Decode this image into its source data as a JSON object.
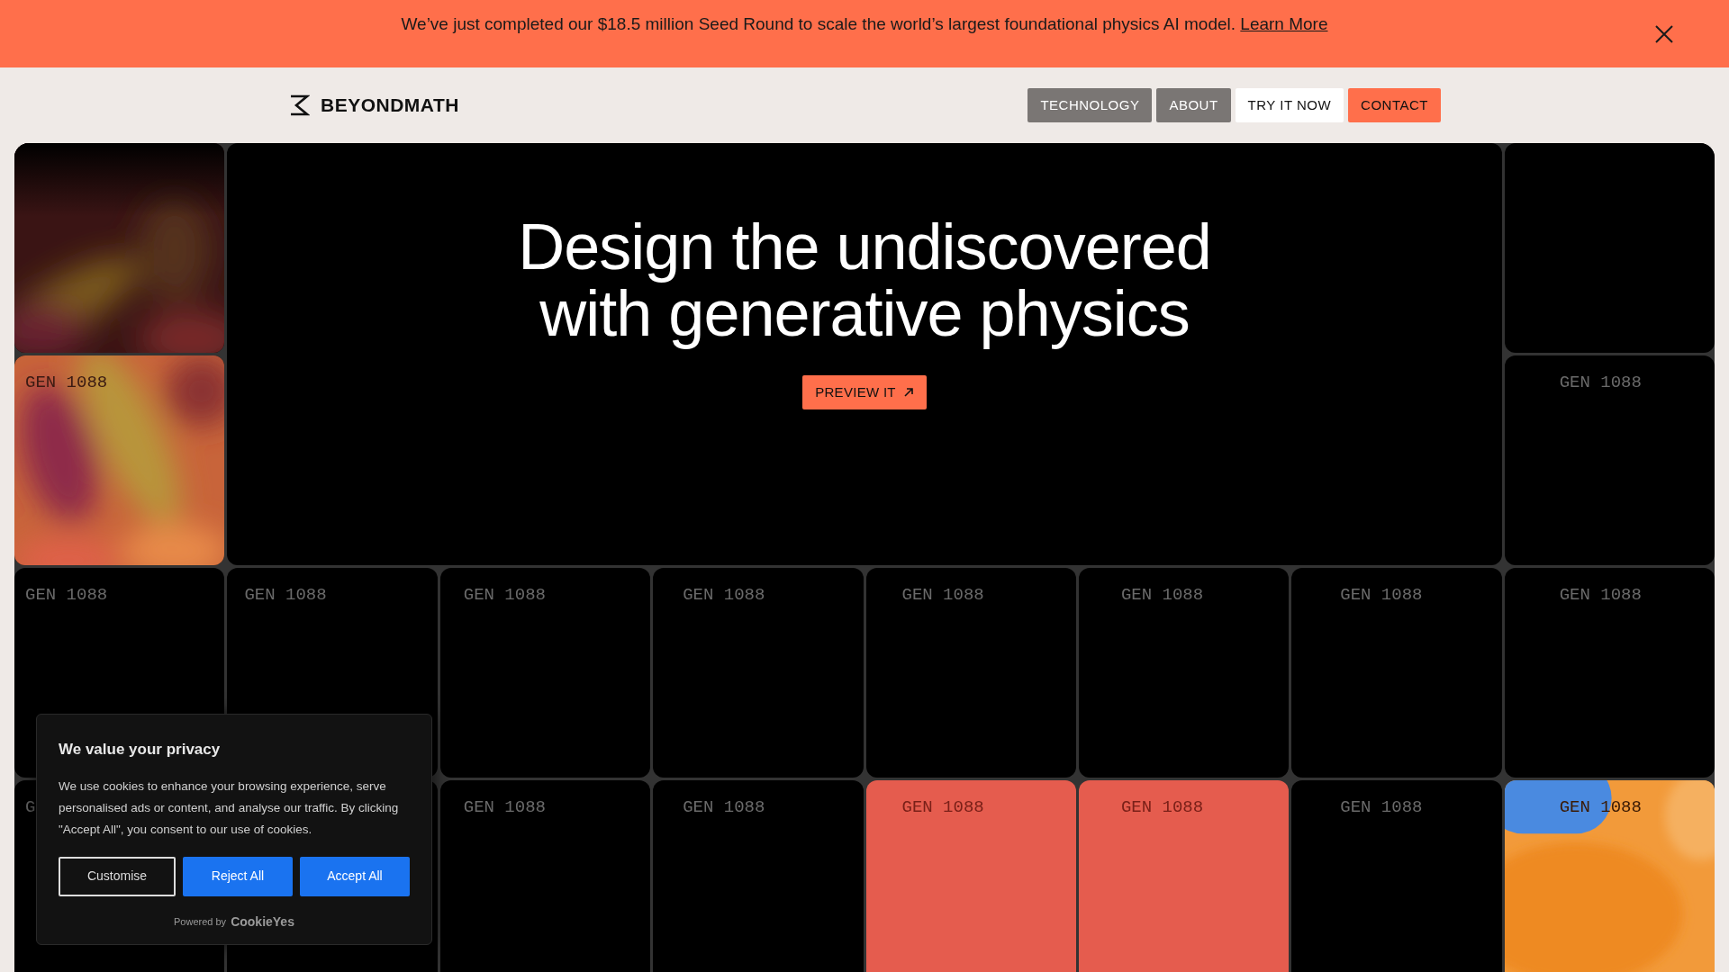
{
  "announcement": {
    "text": "We’ve just completed our $18.5 million Seed Round to scale the world’s largest foundational physics AI model.",
    "link": "Learn More"
  },
  "header": {
    "logo": "BEYONDMATH",
    "nav": [
      {
        "label": "TECHNOLOGY",
        "kind": "gray"
      },
      {
        "label": "ABOUT",
        "kind": "gray"
      },
      {
        "label": "TRY IT NOW",
        "kind": "white"
      },
      {
        "label": "CONTACT",
        "kind": "accent"
      }
    ]
  },
  "hero": {
    "title_lines": [
      "Design the undiscovered",
      "with generative physics"
    ],
    "button": "PREVIEW IT"
  },
  "tiles": [
    {
      "kind": "fade"
    },
    {
      "kind": "dark"
    },
    {
      "kind": "warm",
      "label": "GEN 1088"
    },
    {
      "kind": "dark",
      "label": "GEN 1088"
    },
    {
      "kind": "dark",
      "label": "GEN 1088"
    },
    {
      "kind": "dark",
      "label": "GEN 1088"
    },
    {
      "kind": "dark",
      "label": "GEN 1088"
    },
    {
      "kind": "dark",
      "label": "GEN 1088"
    },
    {
      "kind": "dark",
      "label": "GEN 1088"
    },
    {
      "kind": "dark",
      "label": "GEN 1088"
    },
    {
      "kind": "dark",
      "label": "GEN 1088"
    },
    {
      "kind": "dark",
      "label": "GEN 1088"
    },
    {
      "kind": "dark",
      "label": "G"
    },
    {
      "kind": "dark"
    },
    {
      "kind": "dark",
      "label": "GEN 1088"
    },
    {
      "kind": "dark",
      "label": "GEN 1088"
    },
    {
      "kind": "red",
      "label": "GEN 1088"
    },
    {
      "kind": "red",
      "label": "GEN 1088"
    },
    {
      "kind": "dark",
      "label": "GEN 1088"
    },
    {
      "kind": "blob",
      "label": "GEN 1088"
    }
  ],
  "cookie_notice": {
    "title": "We value your privacy",
    "body": "We use cookies to enhance your browsing experience, serve personalised ads or content, and analyse our traffic. By clicking \"Accept All\", you consent to our use of cookies.",
    "buttons": [
      {
        "label": "Customise",
        "kind": "outline"
      },
      {
        "label": "Reject All",
        "kind": "primary"
      },
      {
        "label": "Accept All",
        "kind": "primary"
      }
    ],
    "powered_by": "Powered by",
    "brand": "CookieYes"
  }
}
